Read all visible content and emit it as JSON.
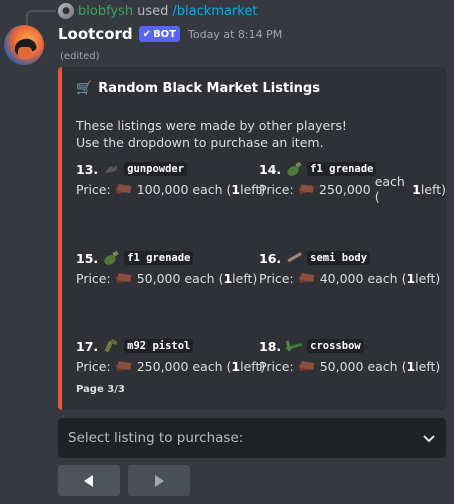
{
  "reply": {
    "username": "blobfysh",
    "used_text": "used",
    "command": "/blackmarket"
  },
  "message": {
    "bot_name": "Lootcord",
    "badge": "BOT",
    "timestamp": "Today at 8:14 PM",
    "edited": "(edited)"
  },
  "embed": {
    "accent_color": "#e8553e",
    "title": "Random Black Market Listings",
    "title_icon": "shopping-cart-icon",
    "description_line1": "These listings were made by other players!",
    "description_line2": "Use the dropdown to purchase an item.",
    "listings": [
      {
        "number": "13.",
        "item_icon": "gunpowder-icon",
        "item": "gunpowder",
        "price_prefix": "Price:",
        "price": "100,000",
        "each_text": "each (",
        "left_count": "1",
        "left_suffix": " left)"
      },
      {
        "number": "14.",
        "item_icon": "grenade-icon",
        "item": "f1 grenade",
        "price_prefix": "Price:",
        "price": "250,000",
        "each_text": "each (",
        "left_count": "1",
        "left_suffix": " left)"
      },
      {
        "number": "15.",
        "item_icon": "grenade-icon",
        "item": "f1 grenade",
        "price_prefix": "Price:",
        "price": "50,000",
        "each_text": "each (",
        "left_count": "1",
        "left_suffix": " left)"
      },
      {
        "number": "16.",
        "item_icon": "body-part-icon",
        "item": "semi body",
        "price_prefix": "Price:",
        "price": "40,000",
        "each_text": "each (",
        "left_count": "1",
        "left_suffix": " left)"
      },
      {
        "number": "17.",
        "item_icon": "pistol-icon",
        "item": "m92 pistol",
        "price_prefix": "Price:",
        "price": "250,000",
        "each_text": "each (",
        "left_count": "1",
        "left_suffix": " left)"
      },
      {
        "number": "18.",
        "item_icon": "crossbow-icon",
        "item": "crossbow",
        "price_prefix": "Price:",
        "price": "50,000",
        "each_text": "each (",
        "left_count": "1",
        "left_suffix": " left)"
      }
    ],
    "page_info": "Page 3/3"
  },
  "dropdown": {
    "placeholder": "Select listing to purchase:"
  },
  "buttons": {
    "prev_icon": "arrow-left-icon",
    "next_icon": "arrow-right-icon"
  }
}
